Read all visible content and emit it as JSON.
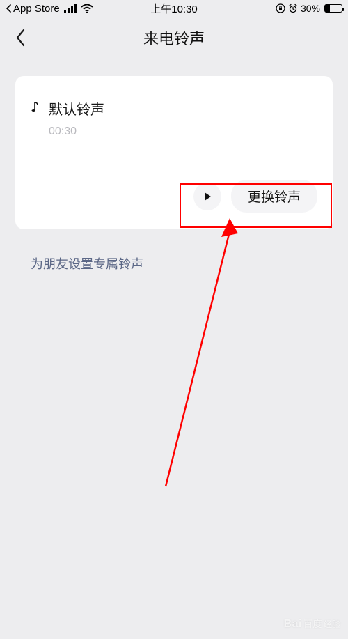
{
  "status": {
    "carrier_text": "App Store",
    "time": "上午10:30",
    "battery_percent": "30%"
  },
  "nav": {
    "title": "来电铃声"
  },
  "card": {
    "ringtone_name": "默认铃声",
    "duration": "00:30",
    "change_label": "更换铃声"
  },
  "link": {
    "set_for_friend": "为朋友设置专属铃声"
  },
  "watermark": {
    "brand": "Bai",
    "brand2": "百度",
    "sub": "经验"
  }
}
